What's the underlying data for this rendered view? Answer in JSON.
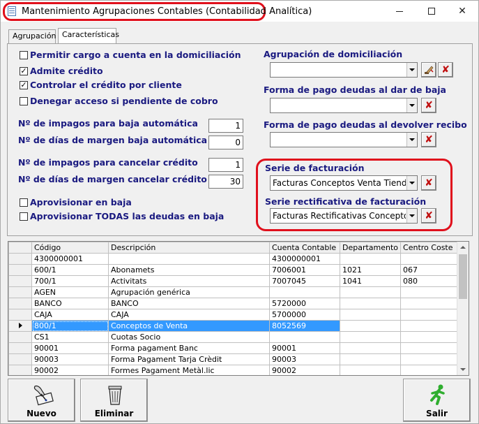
{
  "window": {
    "title": "Mantenimiento Agrupaciones Contables (Contabilidad Analítica)",
    "controls": {
      "minimize": "—",
      "maximize": "☐",
      "close": "✕"
    }
  },
  "tabs": [
    {
      "label": "Agrupación",
      "active": false
    },
    {
      "label": "Características",
      "active": true
    }
  ],
  "checkboxes": [
    {
      "label": "Permitir cargo a cuenta en la domiciliación",
      "checked": false
    },
    {
      "label": "Admite crédito",
      "checked": true
    },
    {
      "label": "Controlar el crédito por cliente",
      "checked": true
    },
    {
      "label": "Denegar acceso si pendiente de cobro",
      "checked": false
    },
    {
      "label": "Aprovisionar en baja",
      "checked": false
    },
    {
      "label": "Aprovisionar TODAS las deudas  en baja",
      "checked": false
    }
  ],
  "numeric_fields": [
    {
      "label": "Nº de impagos para baja automática",
      "value": "1"
    },
    {
      "label": "Nº de días de margen baja automática",
      "value": "0"
    },
    {
      "label": "Nº de impagos para cancelar crédito",
      "value": "1"
    },
    {
      "label": "Nº de días de margen cancelar crédito",
      "value": "30"
    }
  ],
  "combos": [
    {
      "label": "Agrupación de domiciliación",
      "value": ""
    },
    {
      "label": "Forma de pago deudas al dar de baja",
      "value": ""
    },
    {
      "label": "Forma de pago deudas al devolver recibo",
      "value": ""
    },
    {
      "label": "Serie de facturación",
      "value": "Facturas Conceptos Venta Tiend"
    },
    {
      "label": "Serie rectificativa de facturación",
      "value": "Facturas Rectificativas Concepto"
    }
  ],
  "clear_button_glyph": "✘",
  "grid": {
    "columns": [
      "Código",
      "Descripción",
      "Cuenta Contable",
      "Departamento",
      "Centro Coste"
    ],
    "rows": [
      [
        "4300000001",
        "",
        "4300000001",
        "",
        ""
      ],
      [
        "600/1",
        "Abonamets",
        "7006001",
        "1021",
        "067"
      ],
      [
        "700/1",
        "Activitats",
        "7007045",
        "1041",
        "080"
      ],
      [
        "AGEN",
        "Agrupación genérica",
        "",
        "",
        ""
      ],
      [
        "BANCO",
        "BANCO",
        "5720000",
        "",
        ""
      ],
      [
        "CAJA",
        "CAJA",
        "5700000",
        "",
        ""
      ],
      [
        "800/1",
        "Conceptos de Venta",
        "8052569",
        "",
        ""
      ],
      [
        "CS1",
        "Cuotas Socio",
        "",
        "",
        ""
      ],
      [
        "90001",
        "Forma pagament Banc",
        "90001",
        "",
        ""
      ],
      [
        "90003",
        "Forma Pagament Tarja Crèdit",
        "90003",
        "",
        ""
      ],
      [
        "90002",
        "Formes Pagament Metàl.lic",
        "90002",
        "",
        ""
      ]
    ],
    "selected_row": 6
  },
  "buttons": {
    "nuevo": "Nuevo",
    "eliminar": "Eliminar",
    "salir": "Salir"
  },
  "colors": {
    "label_text": "#1a1a80",
    "highlight_red": "#e0101c",
    "selection": "#3399ff"
  }
}
